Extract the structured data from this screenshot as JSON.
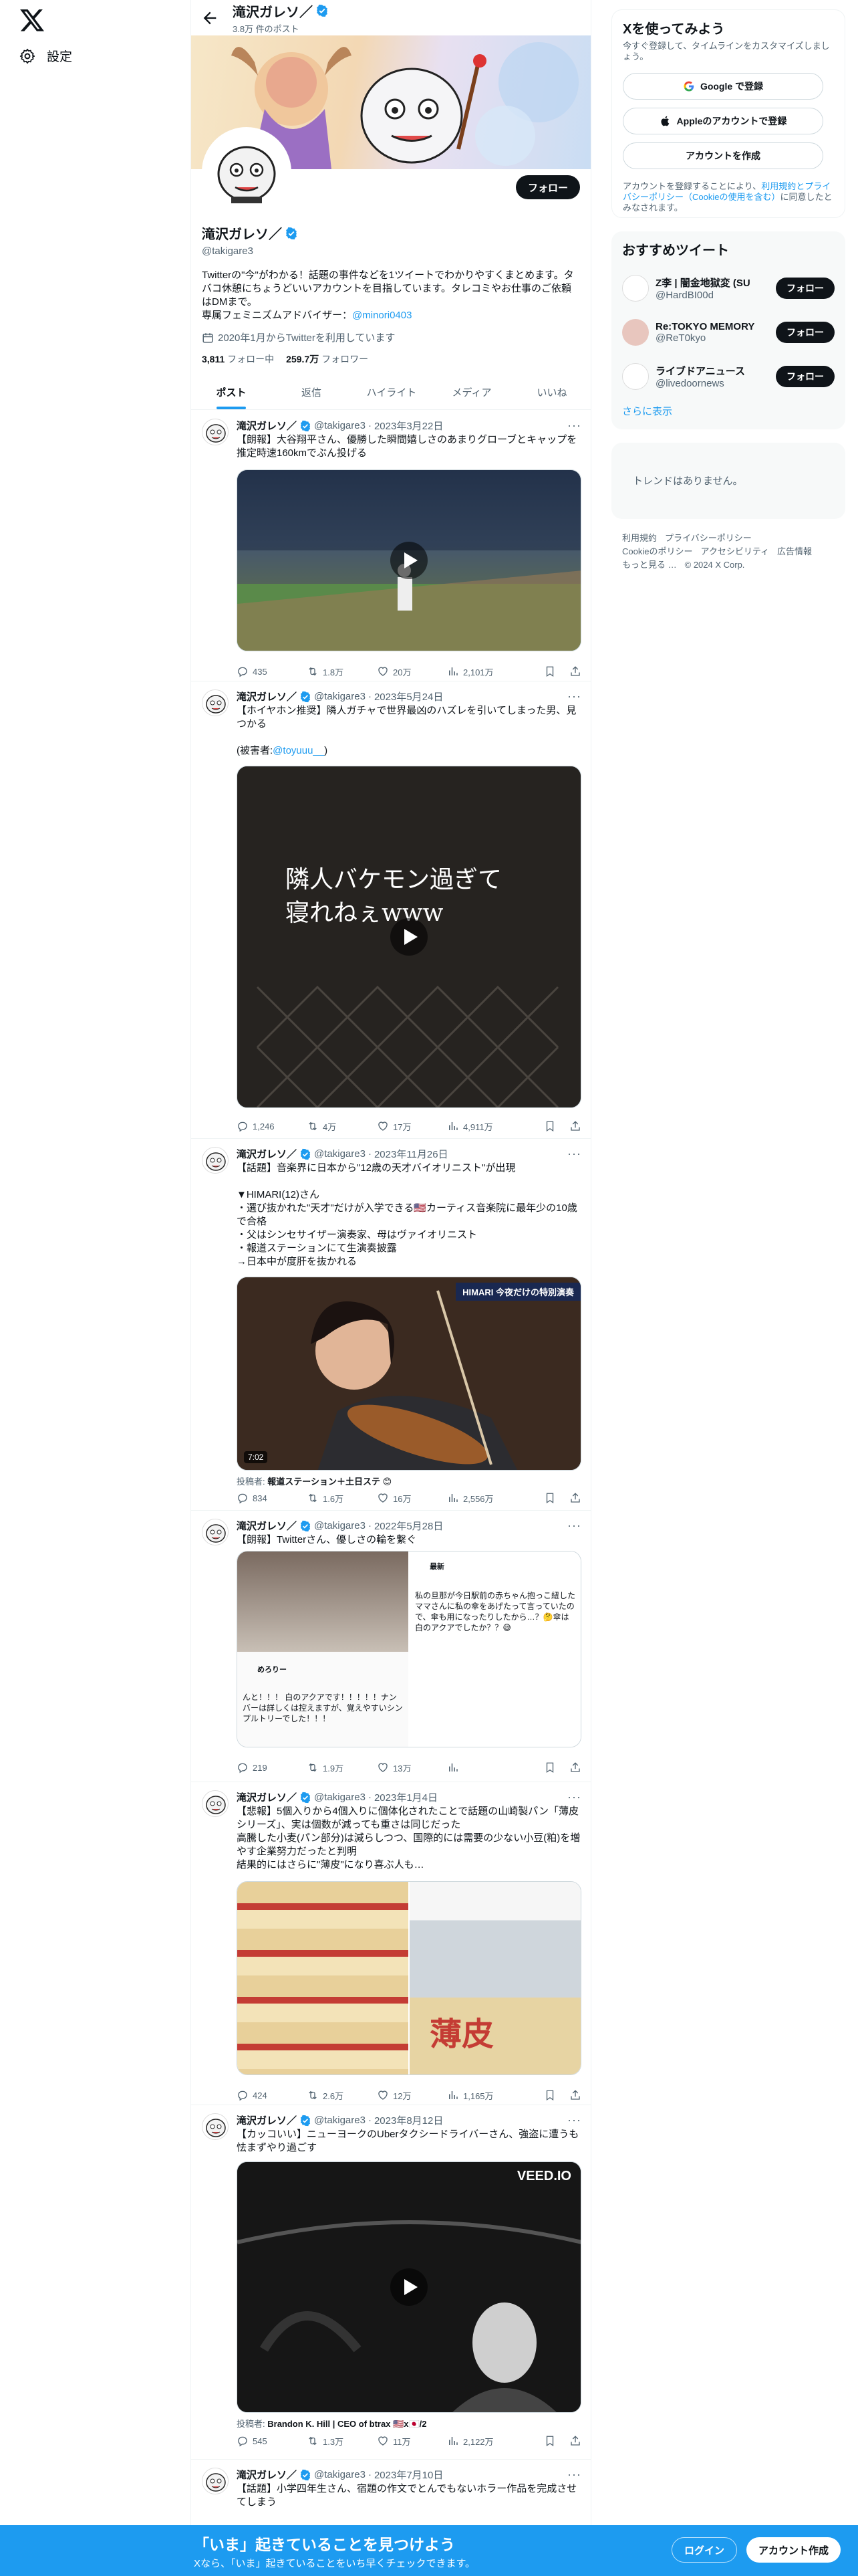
{
  "nav": {
    "settings_label": "設定"
  },
  "header": {
    "name": "滝沢ガレソ／",
    "post_count": "3.8万 件のポスト",
    "follow_label": "フォロー"
  },
  "profile": {
    "name": "滝沢ガレソ／",
    "handle": "@takigare3",
    "bio": "Twitterの\"今\"がわかる！話題の事件などを1ツイートでわかりやすくまとめます。タバコ休憩にちょうどいいアカウントを目指しています。タレコミやお仕事のご依頼はDMまで。\n専属フェミニズムアドバイザー：",
    "bio_link": "@minori0403",
    "joined": "2020年1月からTwitterを利用しています",
    "following_count": "3,811",
    "following_label": "フォロー中",
    "followers_count": "259.7万",
    "followers_label": "フォロワー"
  },
  "tabs": [
    "ポスト",
    "返信",
    "ハイライト",
    "メディア",
    "いいね"
  ],
  "tweets": [
    {
      "name": "滝沢ガレソ／",
      "handle": "@takigare3",
      "date": "2023年3月22日",
      "text": "【朗報】大谷翔平さん、優勝した瞬間嬉しさのあまりグローブとキャップを推定時速160kmでぶん投げる",
      "replies": "435",
      "retweets": "1.8万",
      "likes": "20万",
      "views": "2,101万"
    },
    {
      "name": "滝沢ガレソ／",
      "handle": "@takigare3",
      "date": "2023年5月24日",
      "text": "【ホイヤホン推奨】隣人ガチャで世界最凶のハズレを引いてしまった男、見つかる\n\n(被害者:",
      "link": "@toyuuu__",
      "text_tail": ")",
      "video_caption_1": "隣人バケモン過ぎて",
      "video_caption_2": "寝れねぇwww",
      "replies": "1,246",
      "retweets": "4万",
      "likes": "17万",
      "views": "4,911万"
    },
    {
      "name": "滝沢ガレソ／",
      "handle": "@takigare3",
      "date": "2023年11月26日",
      "text": "【話題】音楽界に日本から\"12歳の天才バイオリニスト\"が出現\n\n▼HIMARI(12)さん\n・選び抜かれた\"天才\"だけが入学できる🇺🇸カーティス音楽院に最年少の10歳で合格\n・父はシンセサイザー演奏家、母はヴァイオリニスト\n・報道ステーションにて生演奏披露\n→日本中が度肝を抜かれる",
      "video_banner": "HIMARI 今夜だけの特別演奏",
      "duration": "7:02",
      "attribution_label": "投稿者:",
      "attribution": "報道ステーション＋土日ステ 😊",
      "replies": "834",
      "retweets": "1.6万",
      "likes": "16万",
      "views": "2,556万"
    },
    {
      "name": "滝沢ガレソ／",
      "handle": "@takigare3",
      "date": "2022年5月28日",
      "text": "【朗報】Twitterさん、優しさの輪を繋ぐ",
      "shot1_name": "めろりー",
      "shot1_text": "んと！！！ 白のアクアです！！！！！ナンバーは詳しくは控えますが、覚えやすいシンプルトリーでした！！！",
      "shot2_name": "最新",
      "shot2_text": "私の旦那が今日駅前の赤ちゃん抱っこ紐したママさんに私の傘をあげたって言っていたので、傘も用になったりしたから…？🤔傘は白のアクアでしたか？？😅",
      "replies": "219",
      "retweets": "1.9万",
      "likes": "13万",
      "views": ""
    },
    {
      "name": "滝沢ガレソ／",
      "handle": "@takigare3",
      "date": "2023年1月4日",
      "text": "【悲報】5個入りから4個入りに個体化されたことで話題の山崎製パン「薄皮シリーズ」、実は個数が減っても重さは同じだった\n高騰した小麦(パン部分)は減らしつつ、国際的には需要の少ない小豆(粕)を増やす企業努力だったと判明\n結果的にはさらに\"薄皮\"になり喜ぶ人も…",
      "photo_label": "薄皮",
      "replies": "424",
      "retweets": "2.6万",
      "likes": "12万",
      "views": "1,165万"
    },
    {
      "name": "滝沢ガレソ／",
      "handle": "@takigare3",
      "date": "2023年8月12日",
      "text": "【カッコいい】ニューヨークのUberタクシードライバーさん、強盗に遭うも怯まずやり過ごす",
      "watermark": "VEED.IO",
      "attribution_label": "投稿者:",
      "attribution": "Brandon K. Hill | CEO of btrax 🇺🇸x🇯🇵/2",
      "replies": "545",
      "retweets": "1.3万",
      "likes": "11万",
      "views": "2,122万"
    },
    {
      "name": "滝沢ガレソ／",
      "handle": "@takigare3",
      "date": "2023年7月10日",
      "text": "【話題】小学四年生さん、宿題の作文でとんでもないホラー作品を完成させてしまう"
    }
  ],
  "signup": {
    "title": "Xを使ってみよう",
    "desc": "今すぐ登録して、タイムラインをカスタマイズしましょう。",
    "google": "Google で登録",
    "apple": "Appleのアカウントで登録",
    "create": "アカウントを作成",
    "terms_prefix": "アカウントを登録することにより、",
    "terms_link": "利用規約とプライバシーポリシー（Cookieの使用を含む）",
    "terms_suffix": "に同意したとみなされます。"
  },
  "recommend": {
    "title": "おすすめツイート",
    "items": [
      {
        "name": "Z李 | 闇金地獄変 (SU",
        "handle": "@HardBI00d",
        "button": "フォロー"
      },
      {
        "name": "Re:TOKYO MEMORY",
        "handle": "@ReT0kyo",
        "button": "フォロー"
      },
      {
        "name": "ライブドアニュース",
        "handle": "@livedoornews",
        "button": "フォロー"
      }
    ],
    "more": "さらに表示"
  },
  "trends": {
    "empty": "トレンドはありません。"
  },
  "footer": [
    "利用規約",
    "プライバシーポリシー",
    "Cookieのポリシー",
    "アクセシビリティ",
    "広告情報",
    "もっと見る …",
    "© 2024 X Corp."
  ],
  "bottom": {
    "title": "「いま」起きていることを見つけよう",
    "subtitle": "Xなら、「いま」起きていることをいち早くチェックできます。",
    "login": "ログイン",
    "create": "アカウント作成"
  },
  "colors": {
    "accent": "#1d9bf0",
    "text": "#0f1419",
    "muted": "#536471"
  }
}
